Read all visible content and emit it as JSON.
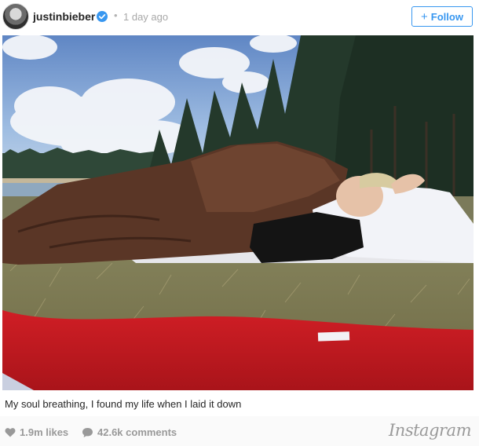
{
  "post": {
    "username": "justinbieber",
    "separator": "•",
    "timestamp": "1 day ago",
    "follow_label": "Follow",
    "follow_plus": "+",
    "caption": "My soul breathing, I found my life when I laid it down",
    "likes": "1.9m likes",
    "comments": "42.6k comments",
    "brand": "Instagram"
  },
  "colors": {
    "accent": "#3897f0",
    "verified_badge": "#3897f0",
    "meta_text": "#999999"
  },
  "icons": {
    "verified": "verified-badge-icon",
    "heart": "heart-icon",
    "comment": "comment-icon"
  }
}
